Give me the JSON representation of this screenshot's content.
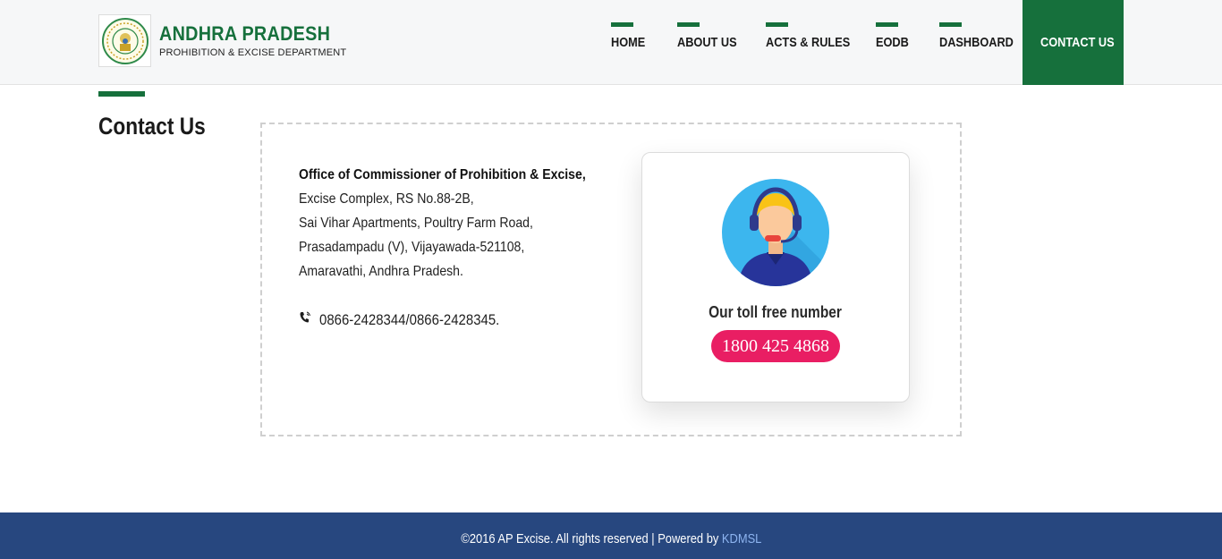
{
  "header": {
    "brand_title": "ANDHRA PRADESH",
    "brand_subtitle": "PROHIBITION & EXCISE DEPARTMENT",
    "logo_icon": "state-emblem-icon"
  },
  "nav": {
    "items": [
      {
        "label": "HOME"
      },
      {
        "label": "ABOUT US"
      },
      {
        "label": "ACTS & RULES"
      },
      {
        "label": "EODB"
      },
      {
        "label": "DASHBOARD"
      }
    ],
    "active": {
      "label": "CONTACT US"
    }
  },
  "page": {
    "title": "Contact Us"
  },
  "address": {
    "org": "Office of Commissioner of Prohibition & Excise,",
    "lines": [
      "Excise Complex, RS No.88-2B,",
      "Sai Vihar Apartments, Poultry Farm Road,",
      "Prasadampadu (V), Vijayawada-521108,",
      "Amaravathi, Andhra Pradesh."
    ],
    "phone": "0866-2428344/0866-2428345."
  },
  "toll": {
    "label": "Our toll free number",
    "number": "1800 425 4868"
  },
  "footer": {
    "text": "©2016 AP Excise. All rights reserved | Powered by",
    "link": "KDMSL"
  },
  "colors": {
    "brand_green": "#16703c",
    "toll_pink": "#e91e63",
    "footer_blue": "#27477f",
    "footer_link": "#8db4f0"
  }
}
